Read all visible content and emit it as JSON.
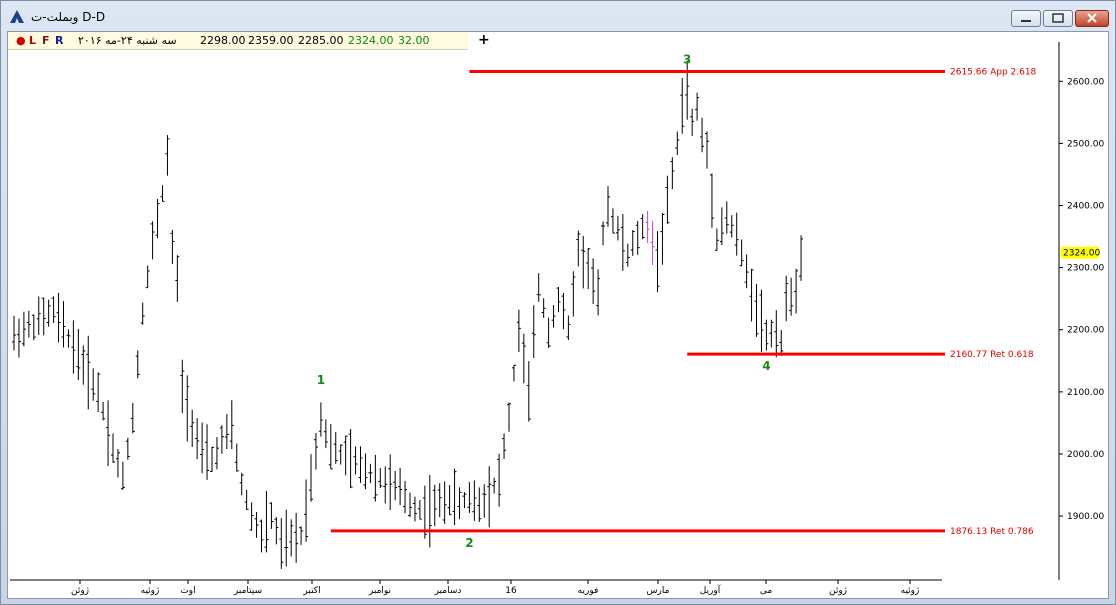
{
  "window": {
    "title": "وبملت-ت D-D",
    "buttons": [
      "minimize",
      "maximize",
      "close"
    ]
  },
  "toolbar": {
    "marker": "●",
    "flags": [
      "L",
      "F",
      "R"
    ],
    "date": "سه شنبه ۲۴-مه ۲۰۱۶",
    "open": "2298.00",
    "high": "2359.00",
    "low": "2285.00",
    "close": "2324.00",
    "change": "32.00",
    "plus": "+"
  },
  "chart_data": {
    "type": "ohlc_bar",
    "y_ticks": [
      1900,
      2000,
      2100,
      2200,
      2300,
      2400,
      2500,
      2600
    ],
    "ylim": [
      1810,
      2660
    ],
    "y_tick_labels": [
      "1900.00",
      "2000.00",
      "2100.00",
      "2200.00",
      "2300.00",
      "2400.00",
      "2500.00",
      "2600.00"
    ],
    "last_price": 2324.0,
    "last_price_label": "2324.00",
    "x_labels": [
      "ژوئن",
      "ژوئیه",
      "اوت",
      "سپتامبر",
      "اکتبر",
      "نوامبر",
      "دسامبر",
      "16",
      "فوریه",
      "مارس",
      "آوریل",
      "می",
      "ژوئن",
      "ژوئیه"
    ],
    "price_path": [
      [
        0,
        2190
      ],
      [
        4,
        2210
      ],
      [
        8,
        2230
      ],
      [
        13,
        2160
      ],
      [
        17,
        2100
      ],
      [
        20,
        2010
      ],
      [
        22,
        1960
      ],
      [
        24,
        2060
      ],
      [
        26,
        2230
      ],
      [
        28,
        2340
      ],
      [
        30,
        2420
      ],
      [
        31,
        2480
      ],
      [
        32,
        2330
      ],
      [
        33,
        2280
      ],
      [
        34,
        2110
      ],
      [
        36,
        2050
      ],
      [
        38,
        2000
      ],
      [
        40,
        1990
      ],
      [
        42,
        2020
      ],
      [
        44,
        2040
      ],
      [
        46,
        1950
      ],
      [
        48,
        1900
      ],
      [
        50,
        1870
      ],
      [
        52,
        1900
      ],
      [
        54,
        1850
      ],
      [
        55,
        1860
      ],
      [
        56,
        1860
      ],
      [
        58,
        1870
      ],
      [
        60,
        1960
      ],
      [
        62,
        2060
      ],
      [
        64,
        2010
      ],
      [
        66,
        2000
      ],
      [
        68,
        1990
      ],
      [
        70,
        1980
      ],
      [
        72,
        1970
      ],
      [
        74,
        1960
      ],
      [
        76,
        1950
      ],
      [
        78,
        1940
      ],
      [
        80,
        1920
      ],
      [
        82,
        1910
      ],
      [
        84,
        1910
      ],
      [
        86,
        1920
      ],
      [
        88,
        1930
      ],
      [
        90,
        1920
      ],
      [
        92,
        1930
      ],
      [
        94,
        1920
      ],
      [
        96,
        1940
      ],
      [
        98,
        1960
      ],
      [
        100,
        2060
      ],
      [
        102,
        2200
      ],
      [
        104,
        2100
      ],
      [
        106,
        2270
      ],
      [
        108,
        2200
      ],
      [
        110,
        2250
      ],
      [
        112,
        2200
      ],
      [
        114,
        2330
      ],
      [
        116,
        2300
      ],
      [
        118,
        2250
      ],
      [
        119,
        2360
      ],
      [
        120,
        2400
      ],
      [
        122,
        2360
      ],
      [
        124,
        2320
      ],
      [
        126,
        2350
      ],
      [
        128,
        2370
      ],
      [
        130,
        2310
      ],
      [
        132,
        2400
      ],
      [
        134,
        2500
      ],
      [
        135,
        2560
      ],
      [
        136,
        2590
      ],
      [
        137,
        2530
      ],
      [
        138,
        2560
      ],
      [
        139,
        2510
      ],
      [
        140,
        2490
      ],
      [
        141,
        2420
      ],
      [
        142,
        2350
      ],
      [
        144,
        2380
      ],
      [
        146,
        2350
      ],
      [
        148,
        2290
      ],
      [
        150,
        2240
      ],
      [
        152,
        2190
      ],
      [
        154,
        2200
      ],
      [
        155,
        2180
      ],
      [
        156,
        2240
      ],
      [
        157,
        2260
      ],
      [
        158,
        2270
      ],
      [
        159,
        2310
      ]
    ],
    "waves": [
      {
        "label": "1",
        "x": 62,
        "price": 2100
      },
      {
        "label": "2",
        "x": 92,
        "price": 1876.13
      },
      {
        "label": "3",
        "x": 136,
        "price": 2615.66
      },
      {
        "label": "4",
        "x": 152,
        "price": 2160.77
      }
    ],
    "levels": [
      {
        "price": 2615.66,
        "label": "2615.66 App 2.618",
        "x_start": 92
      },
      {
        "price": 2160.77,
        "label": "2160.77 Ret 0.618",
        "x_start": 136
      },
      {
        "price": 1876.13,
        "label": "1876.13 Ret 0.786",
        "x_start": 64
      }
    ],
    "highlight_bars": [
      128,
      129
    ],
    "colors": {
      "bars": "#000000",
      "highlight": "#cc44cc",
      "levels": "#ff0000",
      "waves": "#1a8a1a",
      "last_price_bg": "#ffff00"
    }
  }
}
